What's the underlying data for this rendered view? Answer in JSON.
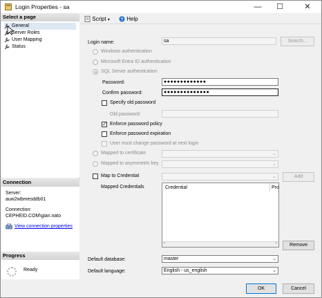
{
  "window": {
    "title": "Login Properties - sa",
    "minimize": "—",
    "maximize": "☐",
    "close": "✕"
  },
  "left": {
    "select_page_header": "Select a page",
    "pages": [
      {
        "label": "General"
      },
      {
        "label": "Server Roles"
      },
      {
        "label": "User Mapping"
      },
      {
        "label": "Status"
      }
    ],
    "connection_header": "Connection",
    "server_label": "Server:",
    "server_value": "auw2wbmesddb01",
    "connection_label": "Connection:",
    "connection_value": "CEPHEID.COM\\gian.nato",
    "view_connection_link": "View connection properties",
    "progress_header": "Progress",
    "progress_status": "Ready"
  },
  "toolbar": {
    "script_label": "Script",
    "help_label": "Help"
  },
  "form": {
    "login_name_label": "Login name:",
    "login_name_value": "sa",
    "search_button": "Search...",
    "auth_windows": "Windows authentication",
    "auth_entra": "Microsoft Entra ID authentication",
    "auth_sql": "SQL Server authentication",
    "password_label": "Password:",
    "password_value": "●●●●●●●●●●●●●",
    "confirm_label": "Confirm password:",
    "confirm_value": "●●●●●●●●●●●●●●",
    "specify_old_label": "Specify old password",
    "old_password_label": "Old password:",
    "enforce_policy_label": "Enforce password policy",
    "enforce_expiration_label": "Enforce password expiration",
    "must_change_label": "User must change password at next login",
    "mapped_cert_label": "Mapped to certificate",
    "mapped_asym_label": "Mapped to asymmetric key",
    "map_credential_label": "Map to Credential",
    "add_button": "Add",
    "mapped_credentials_label": "Mapped Credentials",
    "credential_col": "Credential",
    "provider_col": "Pro",
    "remove_button": "Remove",
    "default_db_label": "Default database:",
    "default_db_value": "master",
    "default_lang_label": "Default language:",
    "default_lang_value": "English - us_english"
  },
  "footer": {
    "ok_button": "OK",
    "cancel_button": "Cancel"
  },
  "colors": {
    "accent": "#0078d7",
    "link": "#0000ee"
  }
}
